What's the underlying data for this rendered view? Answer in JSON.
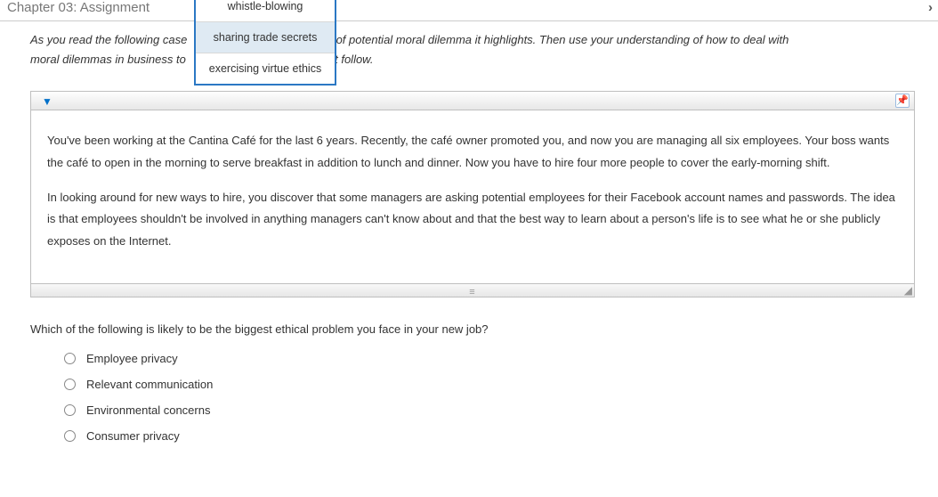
{
  "header": {
    "title": "Chapter 03: Assignment"
  },
  "instructions": {
    "line1_before": "As you read the following case",
    "line1_after": "of potential moral dilemma it highlights. Then use your understanding of how to deal with",
    "line2_before": "moral dilemmas in business to",
    "line2_after": "t follow."
  },
  "dropdown": {
    "options": [
      {
        "label": "whistle-blowing",
        "selected": false
      },
      {
        "label": "sharing trade secrets",
        "selected": true
      },
      {
        "label": "exercising virtue ethics",
        "selected": false
      }
    ]
  },
  "case": {
    "p1": "You've been working at the Cantina Café for the last 6 years. Recently, the café owner promoted you, and now you are managing all six employees. Your boss wants the café to open in the morning to serve breakfast in addition to lunch and dinner. Now you have to hire four more people to cover the early-morning shift.",
    "p2": "In looking around for new ways to hire, you discover that some managers are asking potential employees for their Facebook account names and passwords. The idea is that employees shouldn't be involved in anything managers can't know about and that the best way to learn about a person's life is to see what he or she publicly exposes on the Internet."
  },
  "question": {
    "prompt": "Which of the following is likely to be the biggest ethical problem you face in your new job?",
    "options": [
      "Employee privacy",
      "Relevant communication",
      "Environmental concerns",
      "Consumer privacy"
    ]
  }
}
